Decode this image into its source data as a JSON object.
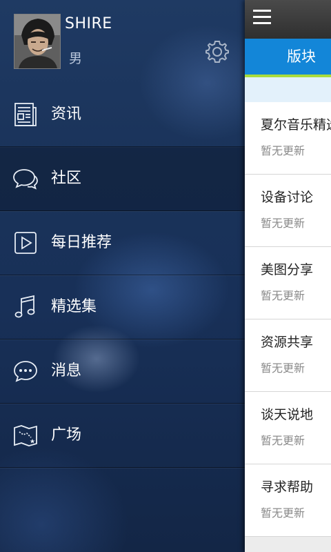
{
  "profile": {
    "name": "SHIRE",
    "gender": "男"
  },
  "menu": {
    "items": [
      {
        "label": "资讯",
        "icon": "news-icon",
        "active": false
      },
      {
        "label": "社区",
        "icon": "chat-bubble-icon",
        "active": true
      },
      {
        "label": "每日推荐",
        "icon": "play-icon",
        "active": false
      },
      {
        "label": "精选集",
        "icon": "music-note-icon",
        "active": false
      },
      {
        "label": "消息",
        "icon": "message-icon",
        "active": false
      },
      {
        "label": "广场",
        "icon": "map-icon",
        "active": false
      }
    ]
  },
  "content": {
    "tab_label": "版块",
    "boards": [
      {
        "title": "夏尔音乐精选",
        "status": "暂无更新"
      },
      {
        "title": "设备讨论",
        "status": "暂无更新"
      },
      {
        "title": "美图分享",
        "status": "暂无更新"
      },
      {
        "title": "资源共享",
        "status": "暂无更新"
      },
      {
        "title": "谈天说地",
        "status": "暂无更新"
      },
      {
        "title": "寻求帮助",
        "status": "暂无更新"
      }
    ]
  },
  "colors": {
    "tab_blue": "#1386d8",
    "tab_underline": "#a9dc3b",
    "drawer_bg": "#1a335a"
  }
}
